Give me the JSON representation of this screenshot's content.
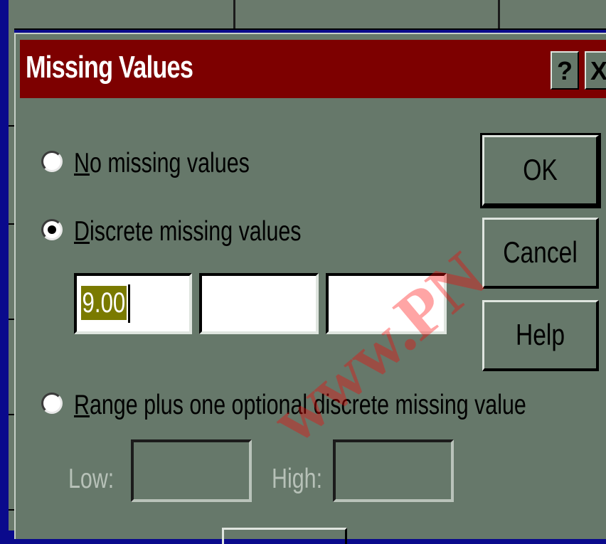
{
  "dialog": {
    "title": "Missing Values",
    "help_glyph": "?",
    "close_glyph": "X"
  },
  "options": {
    "no_missing": {
      "mnemonic": "N",
      "rest": "o missing values",
      "selected": false
    },
    "discrete": {
      "mnemonic": "D",
      "rest": "iscrete missing values",
      "selected": true
    },
    "range": {
      "mnemonic": "R",
      "rest": "ange plus one optional discrete missing value",
      "selected": false
    }
  },
  "discrete_values": [
    "9.00",
    "",
    ""
  ],
  "range_fields": {
    "low_label": "Low:",
    "high_label": "High:",
    "low_value": "",
    "high_value": ""
  },
  "buttons": {
    "ok": "OK",
    "cancel": "Cancel",
    "help": "Help"
  },
  "watermark": "www.PN",
  "colors": {
    "title_bar": "#7d0000",
    "dialog_face": "#66786a",
    "desktop": "#0a0a8c",
    "selection": "#7a7a00"
  }
}
